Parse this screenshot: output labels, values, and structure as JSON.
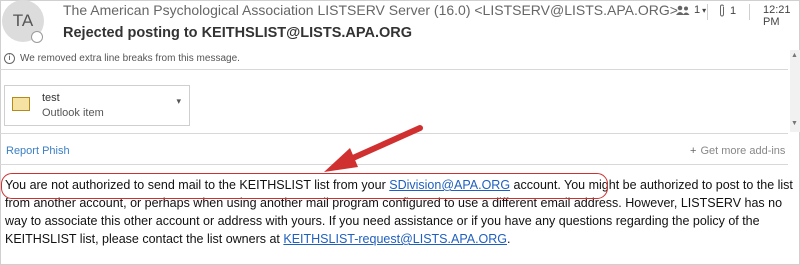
{
  "header": {
    "avatar_initials": "TA",
    "sender": "The American Psychological Association LISTSERV Server (16.0) <LISTSERV@LISTS.APA.ORG>",
    "subject": "Rejected posting to KEITHSLIST@LISTS.APA.ORG",
    "people_count": "1",
    "attachment_count": "1",
    "time": "12:21 PM"
  },
  "infobar": {
    "text": "We removed extra line breaks from this message."
  },
  "attachment": {
    "name": "test",
    "type": "Outlook item"
  },
  "addins": {
    "report_phish": "Report Phish",
    "get_more": "Get more add-ins"
  },
  "message": {
    "p1": "You are not authorized to send mail to the KEITHSLIST list from your ",
    "link1": "SDivision@APA.ORG",
    "p2": " account.",
    "p3": " You might be authorized to post to the list from another account, or perhaps when using another mail program configured to use a different email address. However, LISTSERV has no way to associate this other account or address with yours. If you need assistance or if you have any questions regarding the policy of the KEITHSLIST list, please contact the list owners at ",
    "link2": "KEITHSLIST-request@LISTS.APA.ORG",
    "p4": "."
  },
  "colors": {
    "annotation": "#d03030",
    "link": "#1f5fc0",
    "report_phish": "#3b7fc4"
  }
}
